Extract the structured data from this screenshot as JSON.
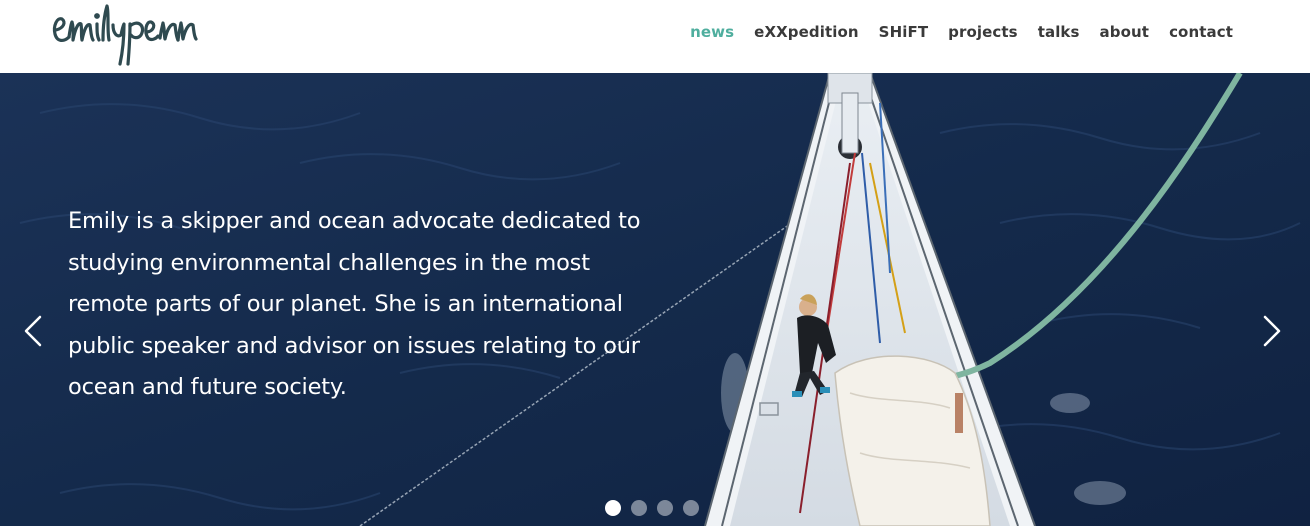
{
  "brand": {
    "logo_text": "emily penn"
  },
  "nav": {
    "items": [
      {
        "label": "news",
        "active": true
      },
      {
        "label": "eXXpedition",
        "active": false
      },
      {
        "label": "SHiFT",
        "active": false
      },
      {
        "label": "projects",
        "active": false
      },
      {
        "label": "talks",
        "active": false
      },
      {
        "label": "about",
        "active": false
      },
      {
        "label": "contact",
        "active": false
      }
    ]
  },
  "hero": {
    "text": "Emily is a skipper and ocean advocate dedicated to studying environmental challenges in the most remote parts of our planet. She is an international public speaker and advisor on issues relating to our ocean and future society.",
    "prev_icon": "chevron-left-icon",
    "next_icon": "chevron-right-icon",
    "slides_total": 4,
    "active_slide": 1
  },
  "colors": {
    "accent": "#4fae9e",
    "nav_text": "#3a3a3a",
    "ocean": "#14294a",
    "logo": "#2f4a50"
  }
}
